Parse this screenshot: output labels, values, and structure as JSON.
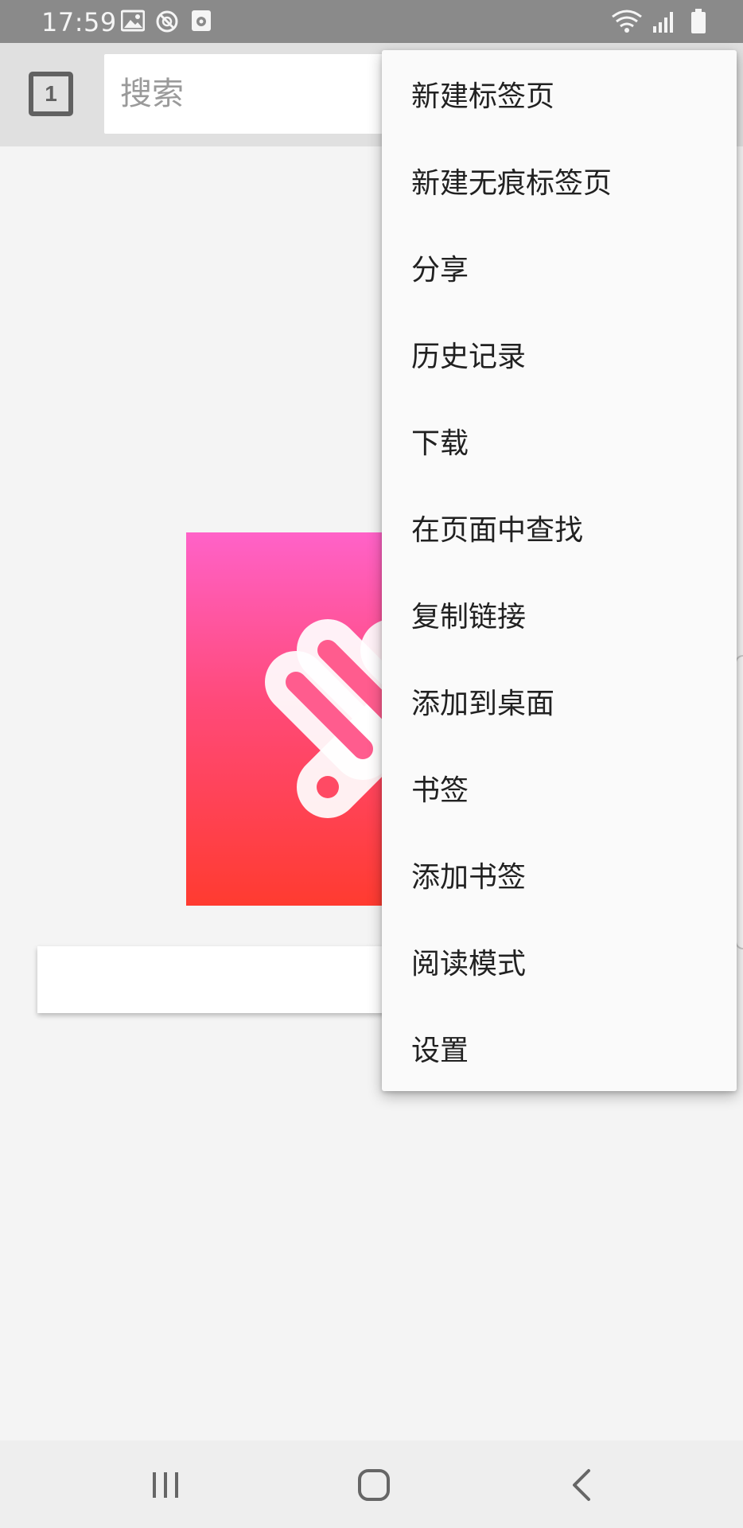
{
  "status_bar": {
    "time": "17:59",
    "left_icons": [
      "image-icon",
      "blocked-icon",
      "media-icon"
    ],
    "right_icons": [
      "wifi-icon",
      "signal-icon",
      "battery-icon"
    ]
  },
  "toolbar": {
    "tab_count": "1",
    "search_placeholder": "搜索"
  },
  "menu": {
    "items": [
      {
        "label": "新建标签页"
      },
      {
        "label": "新建无痕标签页"
      },
      {
        "label": "分享"
      },
      {
        "label": "历史记录"
      },
      {
        "label": "下载"
      },
      {
        "label": "在页面中查找"
      },
      {
        "label": "复制链接"
      },
      {
        "label": "添加到桌面"
      },
      {
        "label": "书签"
      },
      {
        "label": "添加书签"
      },
      {
        "label": "阅读模式"
      },
      {
        "label": "设置"
      }
    ]
  },
  "nav_bar": {
    "buttons": [
      "recent-apps-icon",
      "home-icon",
      "back-icon"
    ]
  },
  "colors": {
    "status_bar": "#8a8a8a",
    "toolbar": "#e0e0e0",
    "menu_bg": "#fafafa",
    "logo_top": "#ff62c8",
    "logo_bottom": "#ff3b30"
  }
}
